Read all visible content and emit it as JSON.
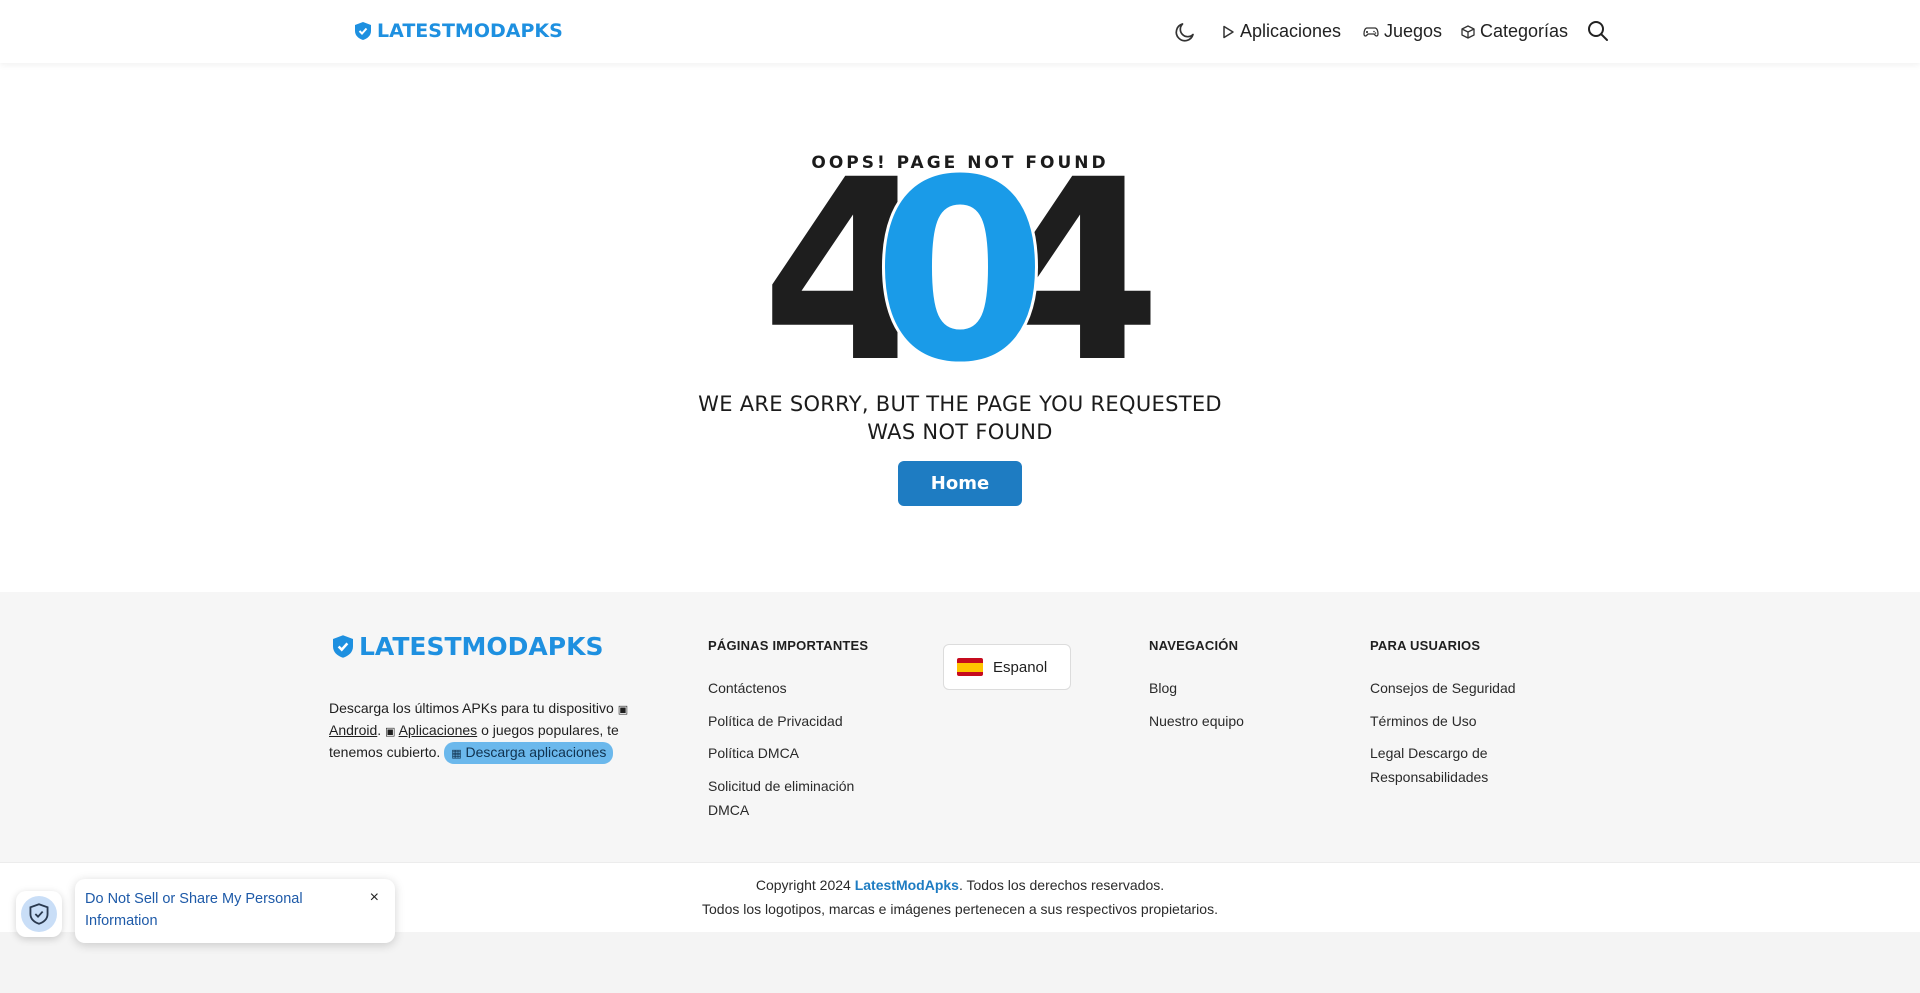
{
  "header": {
    "logo_text": "LATESTMODAPKS",
    "nav": [
      {
        "label": "Aplicaciones",
        "icon": "play-icon"
      },
      {
        "label": "Juegos",
        "icon": "gamepad-icon"
      },
      {
        "label": "Categorías",
        "icon": "cube-icon"
      }
    ],
    "theme_icon": "moon-icon",
    "search_icon": "search-icon"
  },
  "error": {
    "oops": "OOPS! PAGE NOT FOUND",
    "code_left": "4",
    "code_middle": "0",
    "code_right": "4",
    "message_line1": "WE ARE SORRY, BUT THE PAGE YOU REQUESTED",
    "message_line2": "WAS NOT FOUND",
    "home_label": "Home"
  },
  "footer": {
    "logo_text": "LATESTMODAPKS",
    "desc_1": "Descarga los últimos APKs para tu dispositivo",
    "desc_android": "Android",
    "desc_apps": "Aplicaciones",
    "desc_2": "o juegos populares, te tenemos cubierto.",
    "desc_pill": "Descarga aplicaciones",
    "important_title": "PÁGINAS IMPORTANTES",
    "important_links": [
      "Contáctenos",
      "Política de Privacidad",
      "Política DMCA",
      "Solicitud de eliminación DMCA"
    ],
    "language": "Espanol",
    "nav_title": "NAVEGACIÓN",
    "nav_links": [
      "Blog",
      "Nuestro equipo"
    ],
    "users_title": "PARA USUARIOS",
    "users_links": [
      "Consejos de Seguridad",
      "Términos de Uso",
      "Legal Descargo de Responsabilidades"
    ]
  },
  "copyright": {
    "prefix": "Copyright 2024",
    "brand": "LatestModApks",
    "suffix": ". Todos los derechos reservados.",
    "line2": "Todos los logotipos, marcas e imágenes pertenecen a sus respectivos propietarios."
  },
  "privacy": {
    "text": "Do Not Sell or Share My Personal Information",
    "close": "×"
  },
  "colors": {
    "brand_blue": "#1e90e0",
    "button_blue": "#1e7cc2",
    "zero_blue": "#1a9be8",
    "dark": "#1e1e1e"
  }
}
